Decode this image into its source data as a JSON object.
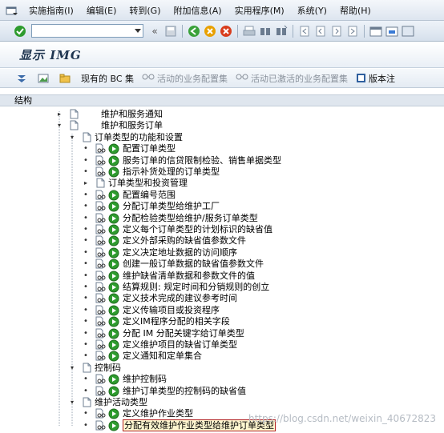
{
  "menu": {
    "items": [
      "实施指南(I)",
      "编辑(E)",
      "转到(G)",
      "附加信息(A)",
      "实用程序(M)",
      "系统(Y)",
      "帮助(H)"
    ]
  },
  "toolbar": {
    "command_value": "",
    "icons": [
      "check-icon",
      "back-icon",
      "save-icon",
      "back-nav-icon",
      "exit-icon",
      "cancel-icon",
      "print-icon",
      "find-icon",
      "find-next-icon",
      "first-page-icon",
      "prev-page-icon",
      "next-page-icon",
      "last-page-icon",
      "new-session-icon",
      "shortcut-icon",
      "layout-icon"
    ]
  },
  "title": "显示 IMG",
  "app_toolbar": {
    "bc_sets": "现有的 BC 集",
    "active_bc_sets": "活动的业务配置集",
    "activated_bc_sets": "活动已激活的业务配置集",
    "release_notes": "版本注"
  },
  "tree": {
    "header": "结构",
    "rows": [
      {
        "label": "维护和服务通知",
        "level": 0,
        "node": "collapsed"
      },
      {
        "label": "维护和服务订单",
        "level": 0,
        "node": "expanded"
      },
      {
        "label": "订单类型的功能和设置",
        "level": 1,
        "node": "expanded"
      },
      {
        "label": "配置订单类型",
        "level": 2,
        "node": "leaf"
      },
      {
        "label": "服务订单的信贷限制检验、销售单据类型",
        "level": 2,
        "node": "leaf"
      },
      {
        "label": "指示补货处理的订单类型",
        "level": 2,
        "node": "leaf"
      },
      {
        "label": "订单类型和投资管理",
        "level": 2,
        "node": "collapsed"
      },
      {
        "label": "配置编号范围",
        "level": 2,
        "node": "leaf"
      },
      {
        "label": "分配订单类型给维护工厂",
        "level": 2,
        "node": "leaf"
      },
      {
        "label": "分配检验类型给维护/服务订单类型",
        "level": 2,
        "node": "leaf"
      },
      {
        "label": "定义每个订单类型的计划标识的缺省值",
        "level": 2,
        "node": "leaf"
      },
      {
        "label": "定义外部采购的缺省值参数文件",
        "level": 2,
        "node": "leaf"
      },
      {
        "label": "定义决定地址数据的访问顺序",
        "level": 2,
        "node": "leaf"
      },
      {
        "label": "创建一般订单数据的缺省值参数文件",
        "level": 2,
        "node": "leaf"
      },
      {
        "label": "维护缺省清单数据和参数文件的值",
        "level": 2,
        "node": "leaf"
      },
      {
        "label": "结算规则: 规定时间和分销规则的创立",
        "level": 2,
        "node": "leaf"
      },
      {
        "label": "定义技术完成的建议参考时间",
        "level": 2,
        "node": "leaf"
      },
      {
        "label": "定义传输项目或投资程序",
        "level": 2,
        "node": "leaf"
      },
      {
        "label": "定义IM程序分配的相关字段",
        "level": 2,
        "node": "leaf"
      },
      {
        "label": "分配 IM 分配关键字给订单类型",
        "level": 2,
        "node": "leaf"
      },
      {
        "label": "定义维护项目的缺省订单类型",
        "level": 2,
        "node": "leaf"
      },
      {
        "label": "定义通知和定单集合",
        "level": 2,
        "node": "leaf"
      },
      {
        "label": "控制码",
        "level": 1,
        "node": "expanded"
      },
      {
        "label": "维护控制码",
        "level": 2,
        "node": "leaf"
      },
      {
        "label": "维护订单类型的控制码的缺省值",
        "level": 2,
        "node": "leaf"
      },
      {
        "label": "维护活动类型",
        "level": 1,
        "node": "expanded"
      },
      {
        "label": "定义维护作业类型",
        "level": 2,
        "node": "leaf"
      },
      {
        "label": "分配有效维护作业类型给维护订单类型",
        "level": 2,
        "node": "leaf",
        "selected": true
      }
    ]
  },
  "watermark": "https://blog.csdn.net/weixin_40672823"
}
